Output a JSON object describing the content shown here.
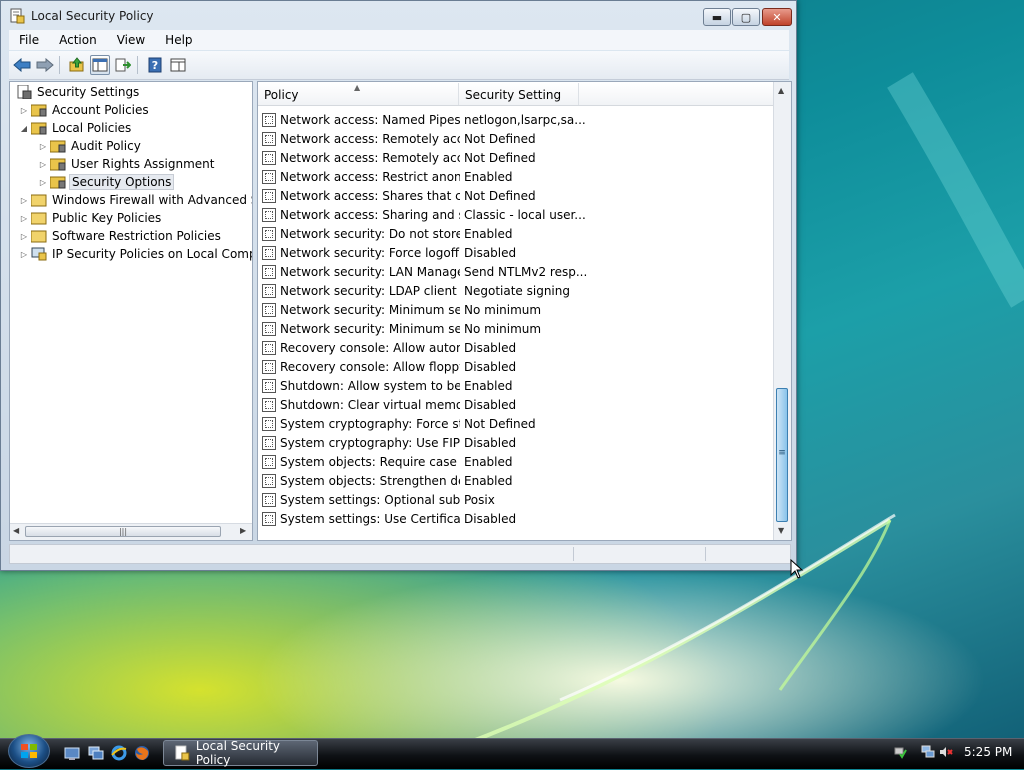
{
  "window": {
    "title": "Local Security Policy",
    "controls": {
      "minimize": "▬",
      "maximize": "▢",
      "close": "✕"
    }
  },
  "menubar": {
    "items": [
      "File",
      "Action",
      "View",
      "Help"
    ]
  },
  "toolbar": {
    "buttons": [
      "back-icon",
      "forward-icon",
      "up-folder-icon",
      "show-hide-tree-icon",
      "export-list-icon",
      "help-icon",
      "view-icon"
    ]
  },
  "tree": {
    "root": "Security Settings",
    "nodes": [
      {
        "label": "Account Policies"
      },
      {
        "label": "Local Policies"
      },
      {
        "label": "Audit Policy"
      },
      {
        "label": "User Rights Assignment"
      },
      {
        "label": "Security Options"
      },
      {
        "label": "Windows Firewall with Advanced Secu"
      },
      {
        "label": "Public Key Policies"
      },
      {
        "label": "Software Restriction Policies"
      },
      {
        "label": "IP Security Policies on Local Compute"
      }
    ]
  },
  "list": {
    "columns": [
      "Policy",
      "Security Setting"
    ],
    "rows": [
      {
        "policy": "Network access: Named Pipes t...",
        "setting": "netlogon,lsarpc,sa..."
      },
      {
        "policy": "Network access: Remotely acce...",
        "setting": "Not Defined"
      },
      {
        "policy": "Network access: Remotely acce...",
        "setting": "Not Defined"
      },
      {
        "policy": "Network access: Restrict anony...",
        "setting": "Enabled"
      },
      {
        "policy": "Network access: Shares that ca...",
        "setting": "Not Defined"
      },
      {
        "policy": "Network access: Sharing and se...",
        "setting": "Classic - local user..."
      },
      {
        "policy": "Network security: Do not store ...",
        "setting": "Enabled"
      },
      {
        "policy": "Network security: Force logoff ...",
        "setting": "Disabled"
      },
      {
        "policy": "Network security: LAN Manage...",
        "setting": "Send NTLMv2 resp..."
      },
      {
        "policy": "Network security: LDAP client si...",
        "setting": "Negotiate signing"
      },
      {
        "policy": "Network security: Minimum ses...",
        "setting": "No minimum"
      },
      {
        "policy": "Network security: Minimum ses...",
        "setting": "No minimum"
      },
      {
        "policy": "Recovery console: Allow autom...",
        "setting": "Disabled"
      },
      {
        "policy": "Recovery console: Allow floppy...",
        "setting": "Disabled"
      },
      {
        "policy": "Shutdown: Allow system to be ...",
        "setting": "Enabled"
      },
      {
        "policy": "Shutdown: Clear virtual memor...",
        "setting": "Disabled"
      },
      {
        "policy": "System cryptography: Force str...",
        "setting": "Not Defined"
      },
      {
        "policy": "System cryptography: Use FIPS ...",
        "setting": "Disabled"
      },
      {
        "policy": "System objects: Require case in...",
        "setting": "Enabled"
      },
      {
        "policy": "System objects: Strengthen def...",
        "setting": "Enabled"
      },
      {
        "policy": "System settings: Optional subsy...",
        "setting": "Posix"
      },
      {
        "policy": "System settings: Use Certificate ...",
        "setting": "Disabled"
      }
    ]
  },
  "taskbar": {
    "task_button": "Local Security Policy",
    "clock": "5:25 PM",
    "tray_icons": [
      "safely-remove-icon",
      "network-icon",
      "volume-muted-icon"
    ],
    "quicklaunch": [
      "show-desktop-icon",
      "switch-windows-icon",
      "internet-explorer-icon",
      "firefox-icon"
    ]
  },
  "colors": {
    "accent": "#3c7fb1",
    "window_frame": "#c9d6e4",
    "close_button": "#c0432b"
  }
}
